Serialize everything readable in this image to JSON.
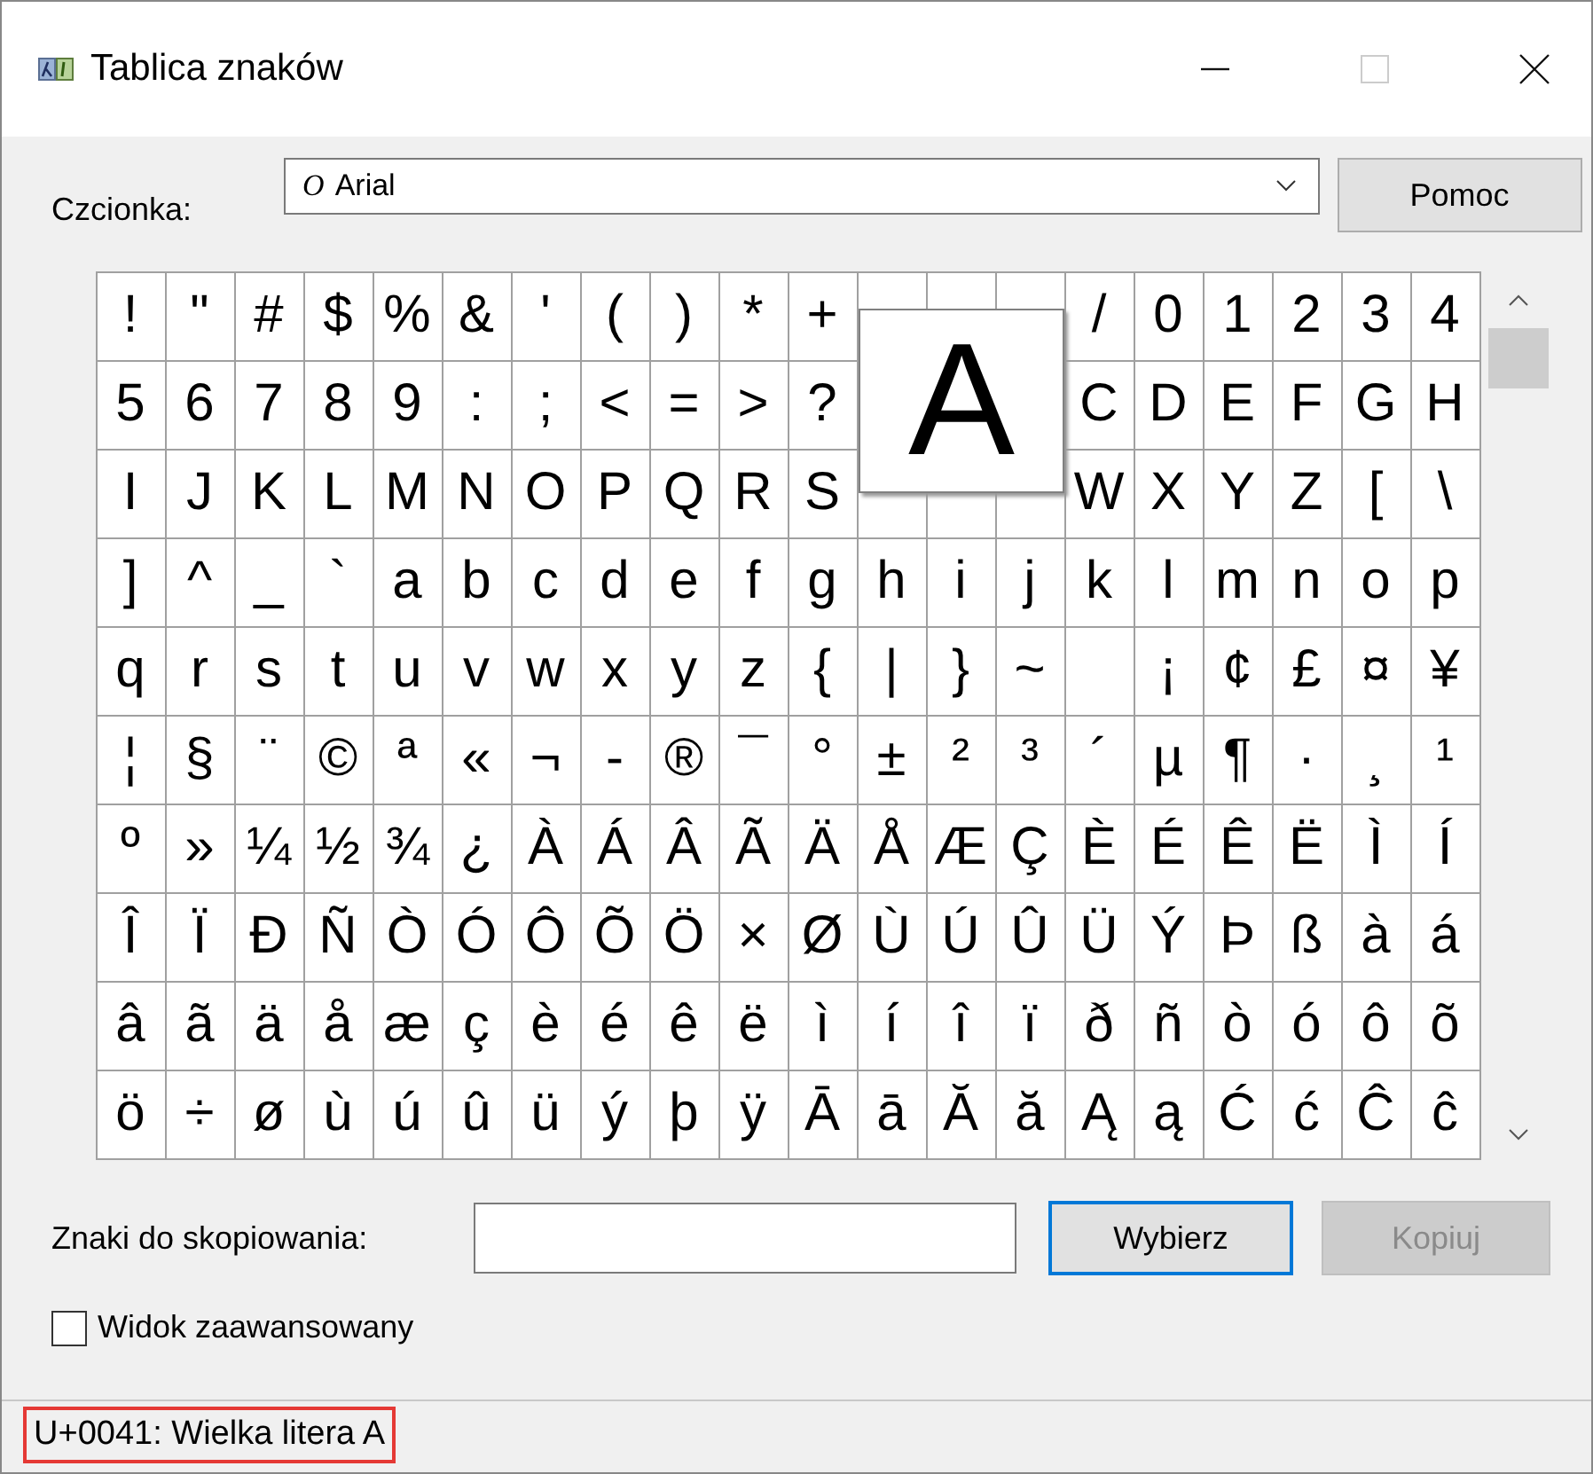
{
  "window": {
    "title": "Tablica znaków",
    "maximize_disabled": true
  },
  "font": {
    "label": "Czcionka:",
    "font_glyph": "O",
    "value": "Arial"
  },
  "help_button": {
    "label": "Pomoc"
  },
  "grid": {
    "rows": [
      [
        "!",
        "\"",
        "#",
        "$",
        "%",
        "&",
        "'",
        "(",
        ")",
        "*",
        "+",
        null,
        null,
        null,
        "/",
        "0",
        "1",
        "2",
        "3",
        "4"
      ],
      [
        "5",
        "6",
        "7",
        "8",
        "9",
        ":",
        ";",
        "<",
        "=",
        ">",
        "?",
        null,
        null,
        null,
        "C",
        "D",
        "E",
        "F",
        "G",
        "H"
      ],
      [
        "I",
        "J",
        "K",
        "L",
        "M",
        "N",
        "O",
        "P",
        "Q",
        "R",
        "S",
        null,
        null,
        null,
        "W",
        "X",
        "Y",
        "Z",
        "[",
        "\\"
      ],
      [
        "]",
        "^",
        "_",
        "`",
        "a",
        "b",
        "c",
        "d",
        "e",
        "f",
        "g",
        "h",
        "i",
        "j",
        "k",
        "l",
        "m",
        "n",
        "o",
        "p"
      ],
      [
        "q",
        "r",
        "s",
        "t",
        "u",
        "v",
        "w",
        "x",
        "y",
        "z",
        "{",
        "|",
        "}",
        "~",
        null,
        "¡",
        "¢",
        "£",
        "¤",
        "¥"
      ],
      [
        "¦",
        "§",
        "¨",
        "©",
        "ª",
        "«",
        "¬",
        "-",
        "®",
        "¯",
        "°",
        "±",
        "²",
        "³",
        "´",
        "µ",
        "¶",
        "·",
        "¸",
        "¹"
      ],
      [
        "º",
        "»",
        "¼",
        "½",
        "¾",
        "¿",
        "À",
        "Á",
        "Â",
        "Ã",
        "Ä",
        "Å",
        "Æ",
        "Ç",
        "È",
        "É",
        "Ê",
        "Ë",
        "Ì",
        "Í"
      ],
      [
        "Î",
        "Ï",
        "Ð",
        "Ñ",
        "Ò",
        "Ó",
        "Ô",
        "Õ",
        "Ö",
        "×",
        "Ø",
        "Ù",
        "Ú",
        "Û",
        "Ü",
        "Ý",
        "Þ",
        "ß",
        "à",
        "á"
      ],
      [
        "â",
        "ã",
        "ä",
        "å",
        "æ",
        "ç",
        "è",
        "é",
        "ê",
        "ë",
        "ì",
        "í",
        "î",
        "ï",
        "ð",
        "ñ",
        "ò",
        "ó",
        "ô",
        "õ"
      ],
      [
        "ö",
        "÷",
        "ø",
        "ù",
        "ú",
        "û",
        "ü",
        "ý",
        "þ",
        "ÿ",
        "Ā",
        "ā",
        "Ă",
        "ă",
        "Ą",
        "ą",
        "Ć",
        "ć",
        "Ĉ",
        "ĉ"
      ]
    ],
    "magnifier": "A"
  },
  "copy": {
    "label": "Znaki do skopiowania:"
  },
  "select_button": {
    "label": "Wybierz",
    "disabled": false
  },
  "copy_button": {
    "label": "Kopiuj",
    "disabled": true
  },
  "advanced_view": {
    "label": "Widok zaawansowany",
    "checked": false
  },
  "status_bar": {
    "text": "U+0041: Wielka litera A",
    "highlighted": true
  }
}
